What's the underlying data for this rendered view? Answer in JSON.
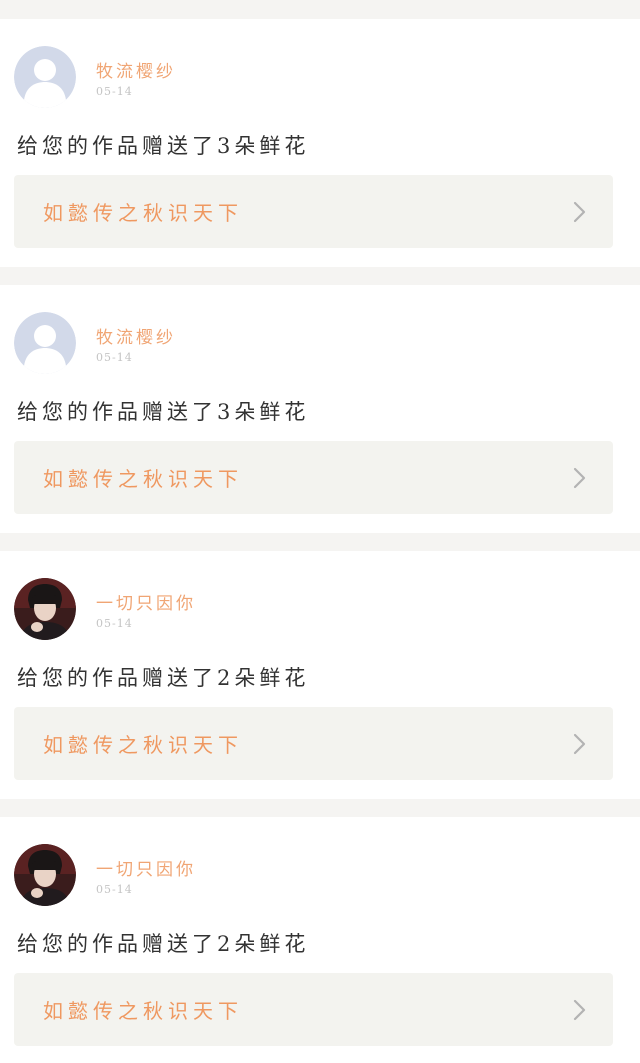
{
  "colors": {
    "page_bg": "#f5f4f2",
    "card_bg": "#ffffff",
    "username": "#f0a574",
    "work_title": "#ef9860",
    "message": "#333333",
    "date": "#c4c4c4",
    "link_bg": "#f3f3ef"
  },
  "notifications": [
    {
      "avatar": "default-avatar-icon",
      "username": "牧流樱纱",
      "date": "05-14",
      "message": "给您的作品赠送了3朵鲜花",
      "work_title": "如懿传之秋识天下",
      "chevron": "chevron-right-icon"
    },
    {
      "avatar": "default-avatar-icon",
      "username": "牧流樱纱",
      "date": "05-14",
      "message": "给您的作品赠送了3朵鲜花",
      "work_title": "如懿传之秋识天下",
      "chevron": "chevron-right-icon"
    },
    {
      "avatar": "user-photo-avatar",
      "username": "一切只因你",
      "date": "05-14",
      "message": "给您的作品赠送了2朵鲜花",
      "work_title": "如懿传之秋识天下",
      "chevron": "chevron-right-icon"
    },
    {
      "avatar": "user-photo-avatar",
      "username": "一切只因你",
      "date": "05-14",
      "message": "给您的作品赠送了2朵鲜花",
      "work_title": "如懿传之秋识天下",
      "chevron": "chevron-right-icon"
    }
  ]
}
